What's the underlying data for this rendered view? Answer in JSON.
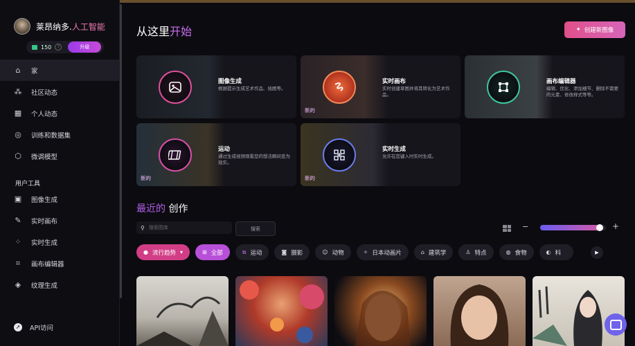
{
  "user": {
    "name": "莱昂纳多.",
    "name_highlight": "人工智能",
    "credits": "150",
    "help": "?",
    "upgrade_label": "升级"
  },
  "nav": [
    {
      "label": "家",
      "icon": "home-icon"
    },
    {
      "label": "社区动态",
      "icon": "community-icon"
    },
    {
      "label": "个人动态",
      "icon": "personal-feed-icon"
    },
    {
      "label": "训练和数据集",
      "icon": "training-icon"
    },
    {
      "label": "微调模型",
      "icon": "model-icon"
    }
  ],
  "tools_section": "用户工具",
  "tools": [
    {
      "label": "图像生成",
      "icon": "image-gen-icon"
    },
    {
      "label": "实时画布",
      "icon": "realtime-canvas-icon"
    },
    {
      "label": "实时生成",
      "icon": "realtime-gen-icon"
    },
    {
      "label": "画布编辑器",
      "icon": "canvas-editor-icon"
    },
    {
      "label": "纹理生成",
      "icon": "texture-icon"
    }
  ],
  "api_label": "API访问",
  "header": {
    "title": "从这里",
    "title_highlight": "开始",
    "create_label": "创建新图像"
  },
  "cards": [
    {
      "title": "图像生成",
      "desc": "根据提示生成艺术作品、插图等。",
      "badge": "",
      "accent": "#e24f9a"
    },
    {
      "title": "实时画布",
      "desc": "实时创建草图并将其转化为艺术作品。",
      "badge": "新的",
      "accent": "#ef6a3c"
    },
    {
      "title": "画布编辑器",
      "desc": "编辑、优化、添加细节、删除不需要的元素、修改样式等等。",
      "badge": "",
      "accent": "#3cc89b"
    },
    {
      "title": "运动",
      "desc": "通过生成视频观看您的想法瞬间变为现实。",
      "badge": "新的",
      "accent": "#d84fa8"
    },
    {
      "title": "实时生成",
      "desc": "允许在您键入时实时生成。",
      "badge": "新的",
      "accent": "#6a7cf0"
    }
  ],
  "recent": {
    "prefix": "最近的",
    "suffix": "创作"
  },
  "search": {
    "placeholder": "搜索图库",
    "button": "搜索"
  },
  "zoom": {
    "level": 0.9
  },
  "chips": [
    {
      "label": "流行趋势",
      "icon": "fire-icon",
      "kind": "trend"
    },
    {
      "label": "全部",
      "icon": "grid-icon",
      "kind": "all"
    },
    {
      "label": "运动",
      "icon": "motion-icon",
      "kind": ""
    },
    {
      "label": "摄影",
      "icon": "camera-icon",
      "kind": ""
    },
    {
      "label": "动物",
      "icon": "animal-icon",
      "kind": ""
    },
    {
      "label": "日本动画片",
      "icon": "anime-icon",
      "kind": ""
    },
    {
      "label": "建筑学",
      "icon": "building-icon",
      "kind": ""
    },
    {
      "label": "特点",
      "icon": "person-icon",
      "kind": ""
    },
    {
      "label": "食物",
      "icon": "food-icon",
      "kind": ""
    },
    {
      "label": "科",
      "icon": "scifi-icon",
      "kind": ""
    }
  ],
  "thumbnails": [
    "ink-landscape-thumbnail",
    "floral-thumbnail",
    "portrait-glow-thumbnail",
    "portrait-woman-thumbnail",
    "ink-character-thumbnail"
  ]
}
